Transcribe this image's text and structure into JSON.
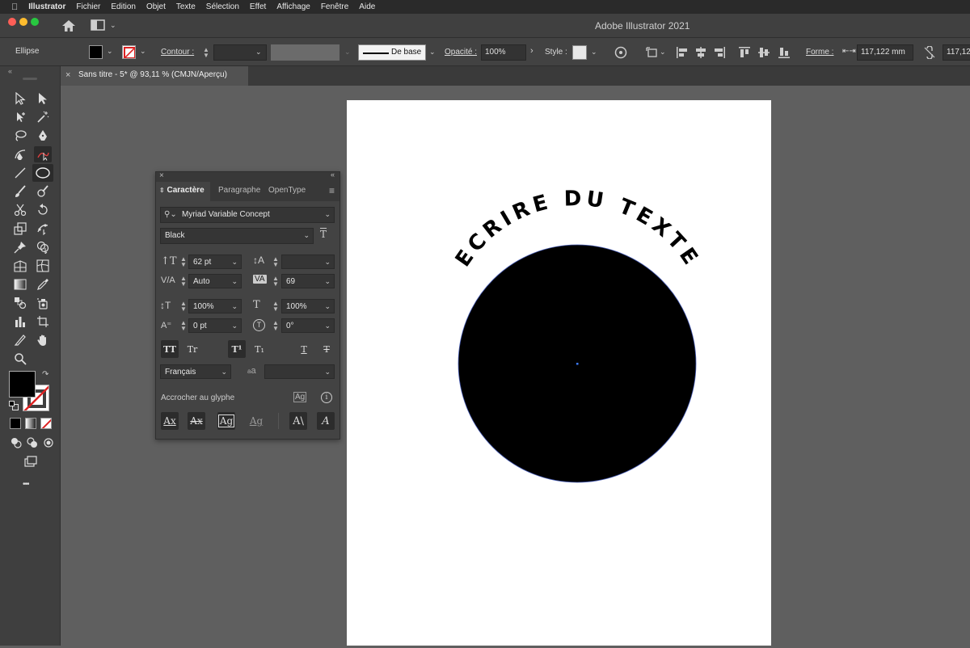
{
  "menubar": {
    "apple_icon": "apple-logo-icon",
    "app_name": "Illustrator",
    "items": [
      "Fichier",
      "Edition",
      "Objet",
      "Texte",
      "Sélection",
      "Effet",
      "Affichage",
      "Fenêtre",
      "Aide"
    ]
  },
  "window": {
    "title": "Adobe Illustrator 2021",
    "traffic_colors": [
      "#ff5f57",
      "#febc2e",
      "#28c840"
    ]
  },
  "control_bar": {
    "object_type": "Ellipse",
    "fill_color": "#000000",
    "contour_label": "Contour :",
    "stroke_profile": "De base",
    "opacity_label": "Opacité :",
    "opacity_value": "100%",
    "style_label": "Style :",
    "forme_label": "Forme :",
    "width_value": "117,122 mm",
    "height_value": "117,12"
  },
  "document": {
    "tab_title": "Sans titre - 5* @ 93,11 % (CMJN/Aperçu)",
    "close_glyph": "×"
  },
  "canvas": {
    "path_text": "ECRIRE DU TEXTE",
    "circle_color": "#000000"
  },
  "char_panel": {
    "tabs": [
      "Caractère",
      "Paragraphe",
      "OpenType"
    ],
    "font_family": "Myriad Variable Concept",
    "font_style": "Black",
    "font_size": "62 pt",
    "leading": "",
    "kerning": "Auto",
    "tracking": "69",
    "vertical_scale": "100%",
    "horizontal_scale": "100%",
    "baseline_shift": "0 pt",
    "rotation": "0°",
    "language": "Français",
    "antialias": "",
    "snap_label": "Accrocher au glyphe",
    "aa_glyph": "a",
    "style_buttons": [
      "TT",
      "Tr",
      "T¹",
      "T₁",
      "T",
      "T"
    ]
  },
  "toolbar": {
    "fill_color": "#000000",
    "more_glyph": "•••"
  }
}
